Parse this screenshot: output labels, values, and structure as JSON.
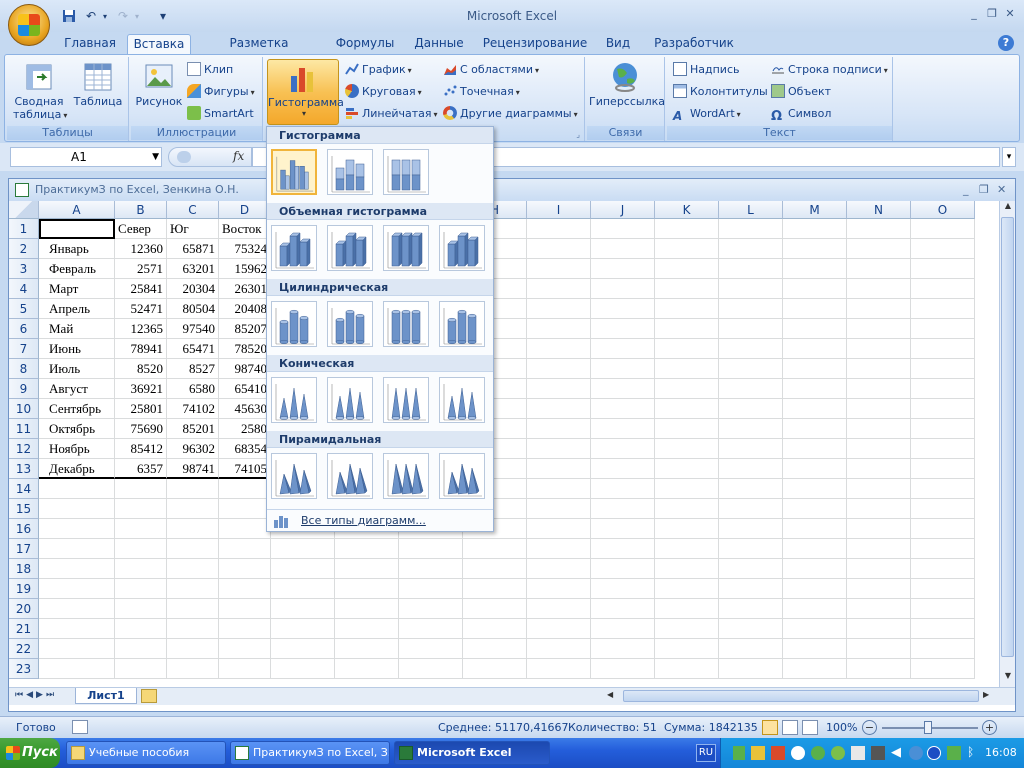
{
  "app_title": "Microsoft Excel",
  "quick_access": [
    "save-icon",
    "undo-icon",
    "redo-icon",
    "customize-icon"
  ],
  "tabs": [
    "Главная",
    "Вставка",
    "Разметка страницы",
    "Формулы",
    "Данные",
    "Рецензирование",
    "Вид",
    "Разработчик"
  ],
  "active_tab": "Вставка",
  "ribbon": {
    "tables": {
      "label": "Таблицы",
      "pivot": "Сводная\nтаблица",
      "pivot_l1": "Сводная",
      "pivot_l2": "таблица",
      "table": "Таблица"
    },
    "illustrations": {
      "label": "Иллюстрации",
      "picture": "Рисунок",
      "clip": "Клип",
      "shapes": "Фигуры",
      "smartart": "SmartArt"
    },
    "charts": {
      "histogram": "Гистограмма",
      "graph": "График",
      "pie": "Круговая",
      "bar": "Линейчатая",
      "area": "С областями",
      "scatter": "Точечная",
      "other": "Другие диаграммы"
    },
    "links": {
      "label": "Связи",
      "hyperlink": "Гиперссылка"
    },
    "text": {
      "label": "Текст",
      "textbox": "Надпись",
      "headers": "Колонтитулы",
      "wordart": "WordArt",
      "signature": "Строка подписи",
      "object": "Объект",
      "symbol": "Символ"
    }
  },
  "formula_bar": {
    "name_box": "A1",
    "fx": "fx",
    "content": ""
  },
  "workbook": {
    "title": "ПрактикумЗ по Excel, Зенкина О.Н.",
    "columns": [
      "A",
      "B",
      "C",
      "D",
      "E",
      "F",
      "G",
      "H",
      "I",
      "J",
      "K",
      "L",
      "M",
      "N",
      "O"
    ],
    "rows": [
      "1",
      "2",
      "3",
      "4",
      "5",
      "6",
      "7",
      "8",
      "9",
      "10",
      "11",
      "12",
      "13",
      "14",
      "15",
      "16",
      "17",
      "18",
      "19",
      "20",
      "21",
      "22",
      "23"
    ],
    "header_row": [
      "",
      "Север",
      "Юг",
      "Восток"
    ],
    "data": [
      [
        "Январь",
        "12360",
        "65871",
        "75324"
      ],
      [
        "Февраль",
        "2571",
        "63201",
        "15962"
      ],
      [
        "Март",
        "25841",
        "20304",
        "26301"
      ],
      [
        "Апрель",
        "52471",
        "80504",
        "20408"
      ],
      [
        "Май",
        "12365",
        "97540",
        "85207"
      ],
      [
        "Июнь",
        "78941",
        "65471",
        "78520"
      ],
      [
        "Июль",
        "8520",
        "8527",
        "98740"
      ],
      [
        "Август",
        "36921",
        "6580",
        "65410"
      ],
      [
        "Сентябрь",
        "25801",
        "74102",
        "45630"
      ],
      [
        "Октябрь",
        "75690",
        "85201",
        "2580"
      ],
      [
        "Ноябрь",
        "85412",
        "96302",
        "68354"
      ],
      [
        "Декабрь",
        "6357",
        "98741",
        "74105"
      ]
    ],
    "sheet_tab": "Лист1"
  },
  "gallery": {
    "sections": [
      "Гистограмма",
      "Объемная гистограмма",
      "Цилиндрическая",
      "Коническая",
      "Пирамидальная"
    ],
    "all_types": "Все типы диаграмм..."
  },
  "status": {
    "ready": "Готово",
    "average": "Среднее: 51170,41667",
    "count": "Количество: 51",
    "sum": "Сумма: 1842135",
    "zoom": "100%"
  },
  "taskbar": {
    "start": "Пуск",
    "tasks": [
      "Учебные пособия",
      "ПрактикумЗ по Excel, З...",
      "Microsoft Excel"
    ],
    "lang": "RU",
    "clock": "16:08"
  }
}
